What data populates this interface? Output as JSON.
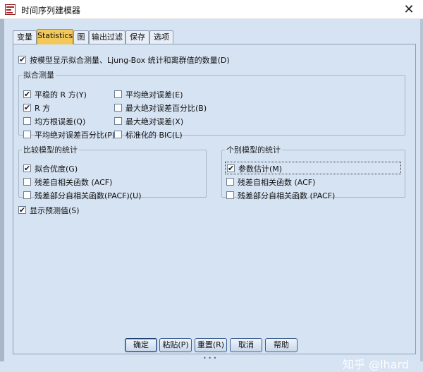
{
  "window": {
    "title": "时间序列建模器",
    "close_glyph": "✕"
  },
  "tabs": [
    {
      "label": "变量",
      "active": false
    },
    {
      "label": "Statistics",
      "active": true
    },
    {
      "label": "图",
      "active": false
    },
    {
      "label": "输出过滤",
      "active": false
    },
    {
      "label": "保存",
      "active": false
    },
    {
      "label": "选项",
      "active": false
    }
  ],
  "display_fit_measures": {
    "label": "按模型显示拟合测量、Ljung-Box 统计和离群值的数量(D)",
    "checked": true
  },
  "fit_measures": {
    "legend": "拟合测量",
    "left": [
      {
        "label": "平稳的 R 方(Y)",
        "checked": true
      },
      {
        "label": "R 方",
        "checked": true
      },
      {
        "label": "均方根误差(Q)",
        "checked": false
      },
      {
        "label": "平均绝对误差百分比(P)",
        "checked": false
      }
    ],
    "right": [
      {
        "label": "平均绝对误差(E)",
        "checked": false
      },
      {
        "label": "最大绝对误差百分比(B)",
        "checked": false
      },
      {
        "label": "最大绝对误差(X)",
        "checked": false
      },
      {
        "label": "标准化的 BIC(L)",
        "checked": false
      }
    ]
  },
  "compare_models": {
    "legend": "比较模型的统计",
    "items": [
      {
        "label": "拟合优度(G)",
        "checked": true
      },
      {
        "label": "残差自相关函数 (ACF)",
        "checked": false
      },
      {
        "label": "残差部分自相关函数(PACF)(U)",
        "checked": false
      }
    ]
  },
  "individual_models": {
    "legend": "个别模型的统计",
    "items": [
      {
        "label": "参数估计(M)",
        "checked": true
      },
      {
        "label": "残差自相关函数 (ACF)",
        "checked": false
      },
      {
        "label": "残差部分自相关函数 (PACF)",
        "checked": false
      }
    ]
  },
  "display_forecasts": {
    "label": "显示预测值(S)",
    "checked": true
  },
  "buttons": {
    "ok": "确定",
    "paste": "粘贴(P)",
    "reset": "重置(R)",
    "cancel": "取消",
    "help": "帮助"
  },
  "watermark": "知乎 @lhard",
  "icons": {
    "check": "✔",
    "app": "time-series-modeler-icon"
  },
  "colors": {
    "active_tab": "#f3c85a",
    "dialog_bg": "#d6e3f3"
  }
}
